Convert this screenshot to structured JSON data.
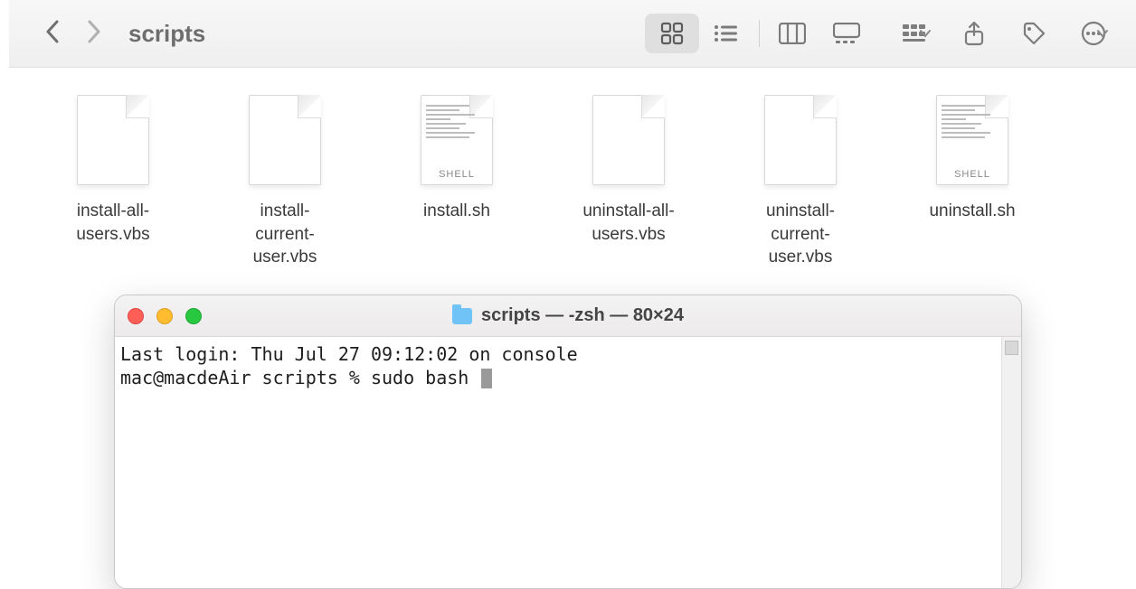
{
  "finder": {
    "title": "scripts",
    "files": [
      {
        "name": "install-all-users.vbs",
        "type": "blank"
      },
      {
        "name": "install-current-user.vbs",
        "type": "blank"
      },
      {
        "name": "install.sh",
        "type": "shell",
        "badge": "SHELL"
      },
      {
        "name": "uninstall-all-users.vbs",
        "type": "blank"
      },
      {
        "name": "uninstall-current-user.vbs",
        "type": "blank"
      },
      {
        "name": "uninstall.sh",
        "type": "shell",
        "badge": "SHELL"
      }
    ]
  },
  "terminal": {
    "title": "scripts — -zsh — 80×24",
    "line1": "Last login: Thu Jul 27 09:12:02 on console",
    "prompt": "mac@macdeAir scripts % ",
    "command": "sudo bash "
  }
}
